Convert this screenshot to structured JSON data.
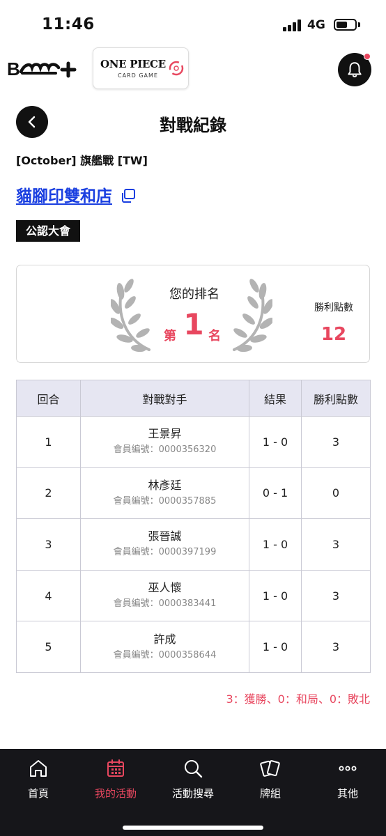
{
  "status_bar": {
    "time": "11:46",
    "network": "4G"
  },
  "header": {
    "app_logo_text": "B-SIDE+",
    "game_logo": {
      "title": "ONE PIECE",
      "subtitle": "CARD GAME"
    }
  },
  "page": {
    "title": "對戰紀錄",
    "event_name": "[October] 旗艦戰 [TW]",
    "store_name": "貓腳印雙和店",
    "badge": "公認大會"
  },
  "ranking": {
    "label": "您的排名",
    "prefix": "第",
    "value": "1",
    "suffix": "名",
    "points_label": "勝利點數",
    "points_value": "12"
  },
  "table": {
    "headers": [
      "回合",
      "對戰對手",
      "結果",
      "勝利點數"
    ],
    "rows": [
      {
        "round": "1",
        "opponent": "王景昇",
        "member": "會員編號：0000356320",
        "result": "1 - 0",
        "points": "3"
      },
      {
        "round": "2",
        "opponent": "林彥廷",
        "member": "會員編號：0000357885",
        "result": "0 - 1",
        "points": "0"
      },
      {
        "round": "3",
        "opponent": "張晉誠",
        "member": "會員編號：0000397199",
        "result": "1 - 0",
        "points": "3"
      },
      {
        "round": "4",
        "opponent": "巫人懷",
        "member": "會員編號：0000383441",
        "result": "1 - 0",
        "points": "3"
      },
      {
        "round": "5",
        "opponent": "許成",
        "member": "會員編號：0000358644",
        "result": "1 - 0",
        "points": "3"
      }
    ]
  },
  "legend_note": "3：獲勝、0：和局、0：敗北",
  "nav": {
    "items": [
      {
        "label": "首頁",
        "icon": "home-icon"
      },
      {
        "label": "我的活動",
        "icon": "calendar-icon",
        "active": true
      },
      {
        "label": "活動搜尋",
        "icon": "search-icon"
      },
      {
        "label": "牌組",
        "icon": "cards-icon"
      },
      {
        "label": "其他",
        "icon": "more-icon"
      }
    ]
  },
  "colors": {
    "accent": "#e8475f",
    "link": "#1a3fe0",
    "dark": "#111111",
    "nav_bg": "#16161a",
    "table_header_bg": "#e6e6f2"
  }
}
